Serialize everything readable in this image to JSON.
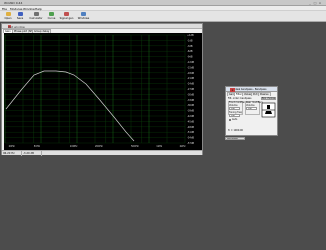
{
  "window": {
    "title": "WinISD 0.44",
    "ctl_min": "_",
    "ctl_max": "□",
    "ctl_close": "×"
  },
  "menu": [
    "File",
    "Modules",
    "Window",
    "Help"
  ],
  "toolbar": [
    {
      "label": "Open",
      "icon": "open-folder-icon",
      "color": "#e0b040"
    },
    {
      "label": "Save",
      "icon": "save-icon",
      "color": "#4060c0"
    },
    {
      "label": "Calculator",
      "icon": "calculator-icon",
      "color": "#707070"
    },
    {
      "label": "Curve",
      "icon": "curve-icon",
      "color": "#50a050"
    },
    {
      "label": "Signal gen",
      "icon": "signal-gen-icon",
      "color": "#c05050"
    },
    {
      "label": "Windows",
      "icon": "windows-icon",
      "color": "#5080c0"
    }
  ],
  "plot_window": {
    "title": "Plot window",
    "tabs": [
      "Gain",
      "Phase plot (SPL)",
      "Group delay"
    ],
    "active_tab": 0,
    "status": [
      "96.20 Hz",
      "-3.20 dB"
    ],
    "y_ticks": [
      "+1dB",
      "-1dB",
      "-3dB",
      "-6dB",
      "-9dB",
      "-12dB",
      "-15dB",
      "-18dB",
      "-21dB",
      "-24dB",
      "-27dB",
      "-30dB",
      "-33dB",
      "-36dB",
      "-39dB",
      "-42dB",
      "-45dB",
      "-48dB",
      "-51dB",
      "-54dB",
      "-57dB"
    ],
    "x_ticks": [
      "20Hz",
      "50Hz",
      "100Hz",
      "200Hz",
      "500Hz",
      "1kHz",
      "2kHz"
    ]
  },
  "colors": {
    "plot_bg": "#000000",
    "grid_major": "#1e9a1e",
    "grid_minor": "#0b4a0b",
    "curve": "#cfcfcf",
    "axis_label": "#dddddd"
  },
  "dialog": {
    "title": "F2, ideal bandpass - Bandpass",
    "close": "×",
    "tabs": [
      "Gain",
      "Filter",
      "Values",
      "Port",
      "Passive"
    ],
    "active_tab": 1,
    "type_label": "Filt. order: bandpass",
    "group1_title": "Front modifiers",
    "field1_label": "Volume",
    "field1_value": "100",
    "group2_title": "Rear modifiers",
    "field2_label": "Volume",
    "field2_value": "100",
    "field3_label": "Tuning freq",
    "field3_value": "100",
    "checkbox_label": "Auto",
    "button_label": "Box choices",
    "footer": "fc = 1000.00"
  },
  "taskbar_item": "Bandpass"
}
